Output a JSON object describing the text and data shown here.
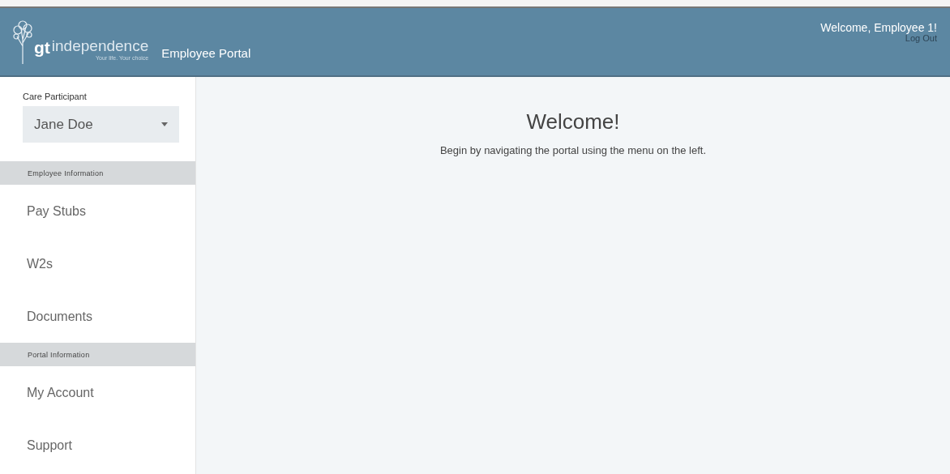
{
  "header": {
    "logo": {
      "mark": "gt",
      "name": "independence",
      "tagline": "Your life. Your choice"
    },
    "title": "Employee Portal",
    "welcome": "Welcome, Employee 1!",
    "logout": "Log Out"
  },
  "sidebar": {
    "participant_label": "Care Participant",
    "participant": {
      "value": "Jane Doe"
    },
    "sections": [
      {
        "heading": "Employee Information",
        "items": [
          {
            "label": "Pay Stubs"
          },
          {
            "label": "W2s"
          },
          {
            "label": "Documents"
          }
        ]
      },
      {
        "heading": "Portal Information",
        "items": [
          {
            "label": "My Account"
          },
          {
            "label": "Support"
          }
        ]
      }
    ]
  },
  "main": {
    "title": "Welcome!",
    "text": "Begin by navigating the portal using the menu on the left."
  }
}
